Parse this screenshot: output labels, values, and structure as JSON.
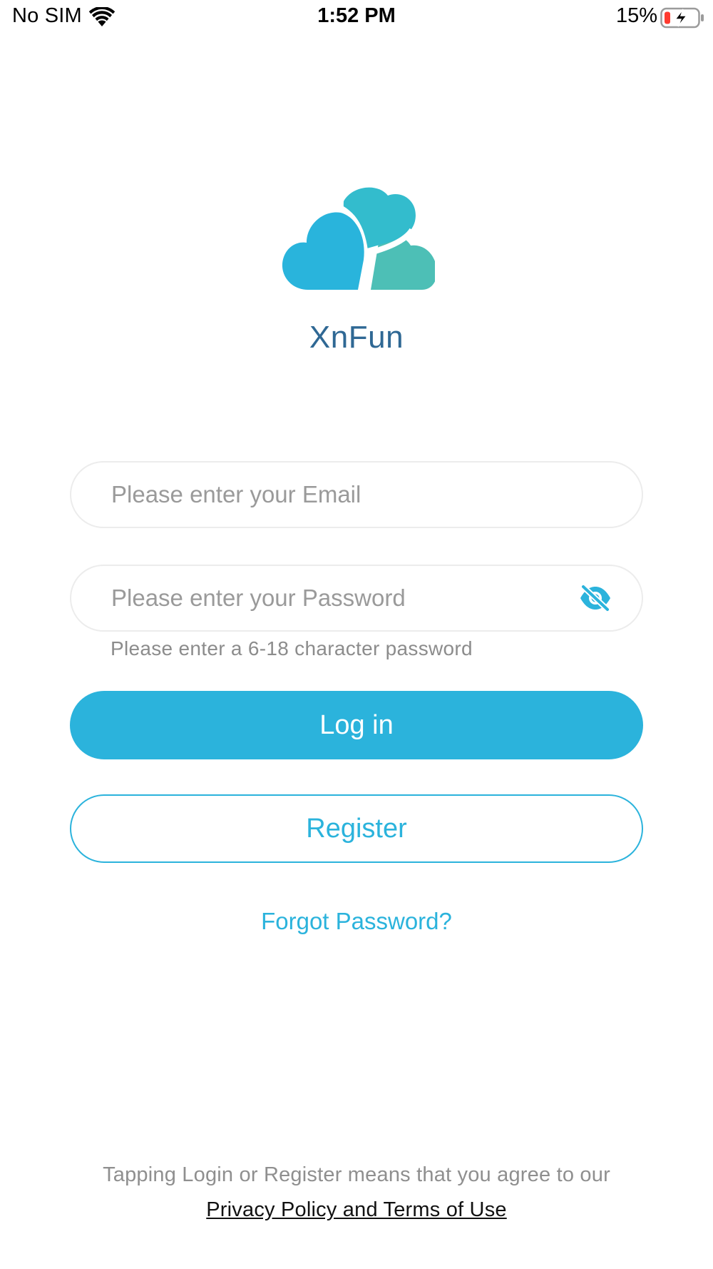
{
  "status_bar": {
    "carrier": "No SIM",
    "time": "1:52 PM",
    "battery_percent": "15%",
    "icons": [
      "wifi-icon",
      "battery-charging-icon"
    ]
  },
  "brand": {
    "app_name": "XnFun",
    "logo": "cloud-hearts-logo",
    "colors": {
      "primary": "#2bb3dc",
      "app_name": "#2f6894",
      "logo_front": "#29b4dc",
      "logo_top": "#33bccd",
      "logo_back": "#4dbfb6"
    }
  },
  "form": {
    "email": {
      "placeholder": "Please enter your Email",
      "value": ""
    },
    "password": {
      "placeholder": "Please enter your Password",
      "value": "",
      "toggle_icon": "eye-slash-icon"
    },
    "hint": "Please enter a 6-18 character password"
  },
  "buttons": {
    "login": "Log in",
    "register": "Register",
    "forgot": "Forgot Password?"
  },
  "footer": {
    "notice": "Tapping Login or Register means that you agree to our",
    "policy_link": "Privacy Policy and Terms of Use"
  }
}
